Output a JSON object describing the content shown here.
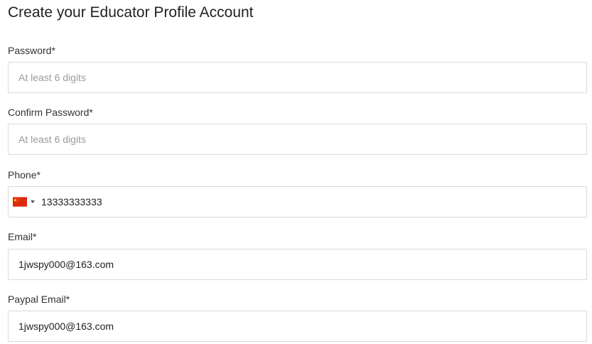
{
  "page": {
    "title": "Create your Educator Profile Account"
  },
  "form": {
    "password": {
      "label": "Password*",
      "placeholder": "At least 6 digits",
      "value": ""
    },
    "confirm_password": {
      "label": "Confirm Password*",
      "placeholder": "At least 6 digits",
      "value": ""
    },
    "phone": {
      "label": "Phone*",
      "country_flag": "china-flag-icon",
      "value": "13333333333"
    },
    "email": {
      "label": "Email*",
      "value": "1jwspy000@163.com"
    },
    "paypal_email": {
      "label": "Paypal Email*",
      "value": "1jwspy000@163.com"
    }
  },
  "colors": {
    "field_border": "#d9d9d9",
    "placeholder": "#9b9b9b",
    "flag_red": "#de2910",
    "flag_star": "#ffde00"
  }
}
